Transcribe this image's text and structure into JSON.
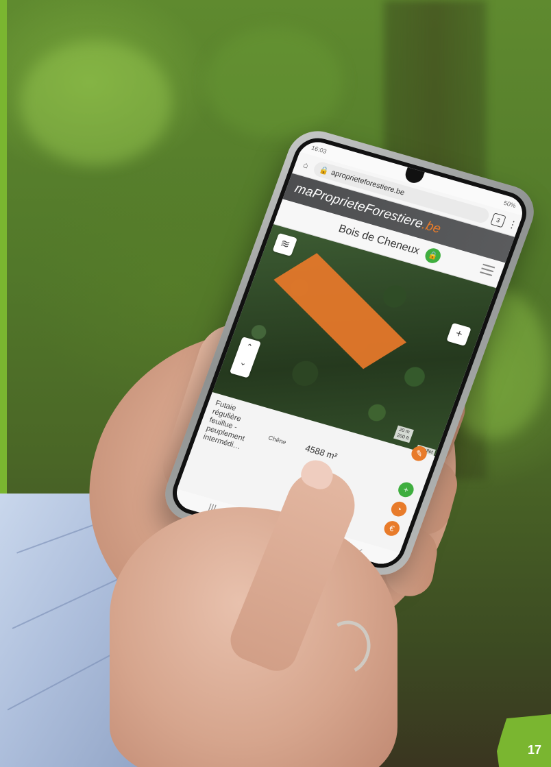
{
  "page": {
    "number": "17"
  },
  "phone": {
    "status": {
      "time": "16:03",
      "battery": "50%"
    },
    "browser": {
      "url": "aproprieteforestiere.be",
      "tab_count": "3"
    },
    "site": {
      "brand_main": "maProprieteForestiere",
      "brand_tld": ".be"
    },
    "header": {
      "title": "Bois de Cheneux"
    },
    "map": {
      "zoom_in": "+",
      "scale_labels": [
        "20 m",
        "200 ft"
      ],
      "attribution": "Leaflet",
      "parcel_color": "#e7792a"
    },
    "stand": {
      "description": "Futaie régulière feuillue - peuplement intermédi…",
      "species": "Chêne",
      "area": "4588 m²"
    },
    "colors": {
      "accent": "#e87b2a",
      "lock": "#3fae3f",
      "badge": "#7ab630"
    }
  }
}
